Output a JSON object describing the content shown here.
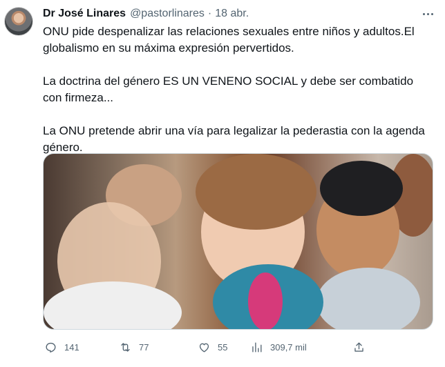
{
  "tweet": {
    "author_name": "Dr José Linares",
    "handle": "@pastorlinares",
    "separator": "·",
    "date": "18 abr.",
    "paragraphs": [
      "ONU pide despenalizar las relaciones sexuales entre niños y adultos.El globalismo en su máxima expresión  pervertidos.",
      "La doctrina del género ES UN VENENO SOCIAL y debe ser combatido con firmeza...",
      "La ONU pretende abrir una vía para legalizar la pederastia con la agenda género."
    ]
  },
  "actions": {
    "replies": "141",
    "retweets": "77",
    "likes": "55",
    "views": "309,7 mil"
  },
  "icons": [
    "more-icon",
    "reply-icon",
    "retweet-icon",
    "like-icon",
    "views-icon",
    "share-icon"
  ],
  "colors": {
    "text_primary": "#0f1419",
    "text_secondary": "#536471",
    "border": "#cfd9de"
  }
}
